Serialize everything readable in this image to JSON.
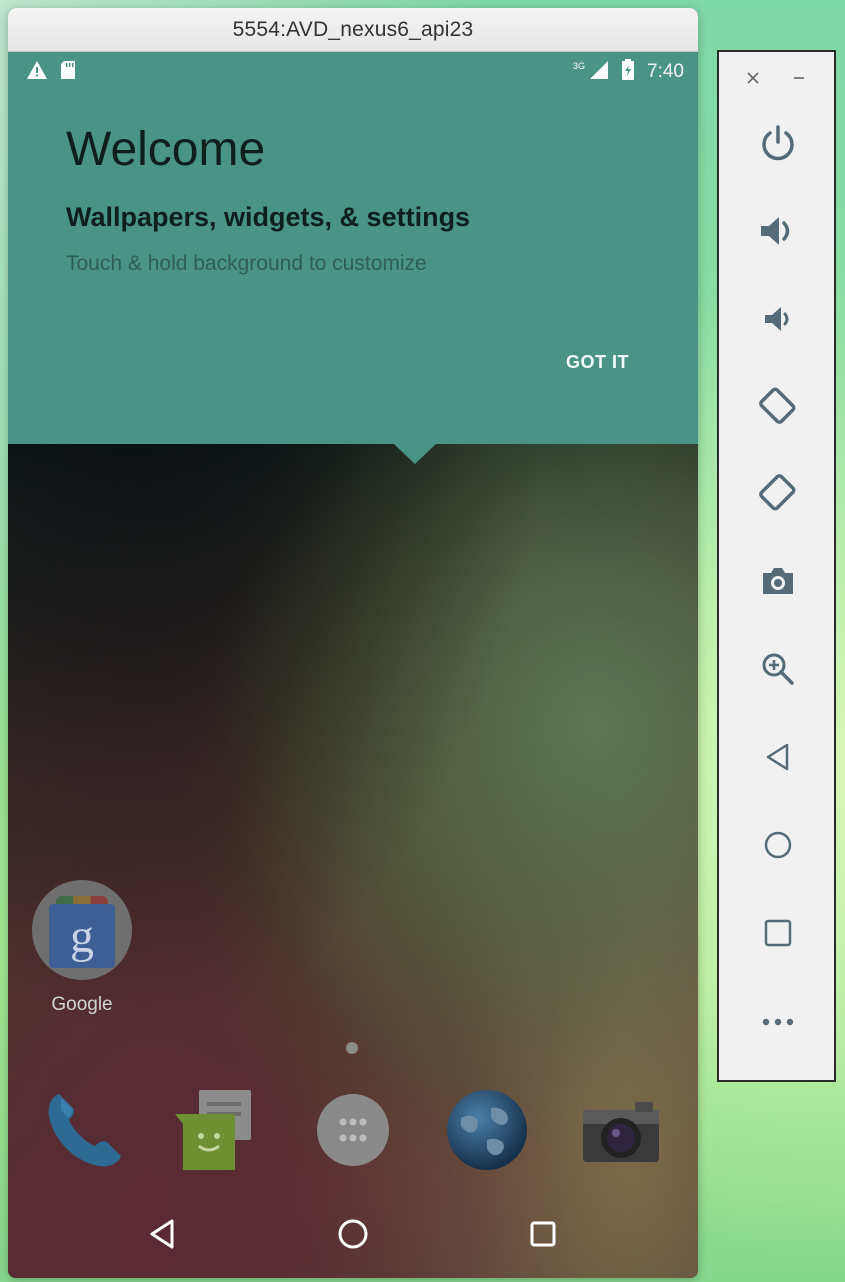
{
  "window": {
    "title": "5554:AVD_nexus6_api23"
  },
  "status_bar": {
    "time": "7:40",
    "network": "3G"
  },
  "welcome": {
    "title": "Welcome",
    "subtitle": "Wallpapers, widgets, & settings",
    "hint": "Touch & hold background to customize",
    "button": "GOT IT",
    "color": "#4a9486"
  },
  "home": {
    "apps": [
      {
        "label": "Google",
        "icon": "google-folder-icon"
      }
    ],
    "dock": [
      {
        "name": "phone",
        "icon": "phone-icon"
      },
      {
        "name": "messaging",
        "icon": "messaging-icon"
      },
      {
        "name": "app-drawer",
        "icon": "app-drawer-icon"
      },
      {
        "name": "browser",
        "icon": "browser-globe-icon"
      },
      {
        "name": "camera",
        "icon": "camera-icon"
      }
    ]
  },
  "nav_bar": {
    "buttons": [
      "back",
      "home",
      "recents"
    ]
  },
  "control_panel": {
    "buttons": [
      {
        "name": "power",
        "icon": "power-icon"
      },
      {
        "name": "volume-up",
        "icon": "volume-up-icon"
      },
      {
        "name": "volume-down",
        "icon": "volume-down-icon"
      },
      {
        "name": "rotate-left",
        "icon": "rotate-left-icon"
      },
      {
        "name": "rotate-right",
        "icon": "rotate-right-icon"
      },
      {
        "name": "screenshot",
        "icon": "camera-icon"
      },
      {
        "name": "zoom",
        "icon": "zoom-in-icon"
      },
      {
        "name": "back",
        "icon": "back-icon"
      },
      {
        "name": "home",
        "icon": "home-icon"
      },
      {
        "name": "overview",
        "icon": "overview-icon"
      },
      {
        "name": "more",
        "icon": "more-icon"
      }
    ]
  }
}
